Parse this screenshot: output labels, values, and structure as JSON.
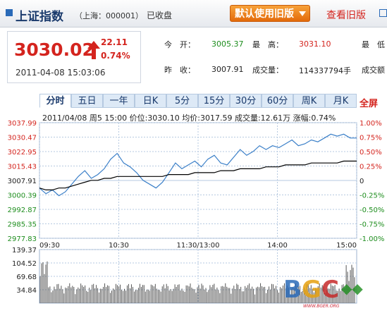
{
  "header": {
    "title": "上证指数",
    "exchange": "（上海：000001）",
    "status": "已收盘",
    "old_version_button": "默认使用旧版",
    "old_version_link": "查看旧版"
  },
  "quote": {
    "price": "3030.02",
    "change": "22.11",
    "change_pct": "0.74%",
    "timestamp": "2011-04-08 15:03:06",
    "open_label": "今　开：",
    "open": "3005.37",
    "high_label": "最　高：",
    "high": "3031.10",
    "low_label_partial": "最　低",
    "prev_close_label": "昨　收：",
    "prev_close": "3007.91",
    "volume_label": "成交量：",
    "volume": "114337794手",
    "amount_label_partial": "成交额"
  },
  "tabs": [
    "分时",
    "五日",
    "一年",
    "日K",
    "5分",
    "15分",
    "30分",
    "60分",
    "周K",
    "月K"
  ],
  "active_tab": "分时",
  "fullscreen": "全屏",
  "info_line": "2011/04/08  周5  15:00  价位:3030.10  均价:3017.59  成交量:12.61万  涨幅:0.74%",
  "colors": {
    "up": "#d4241e",
    "down": "#1d8d1d",
    "price_line": "#3a7fc8",
    "avg_line": "#000000",
    "grid": "#b6c9e0"
  },
  "chart_data": {
    "type": "line",
    "y_left_ticks": [
      "3037.99",
      "3030.47",
      "3022.95",
      "3015.43",
      "3007.91",
      "3000.39",
      "2992.87",
      "2985.35",
      "2977.83"
    ],
    "y_right_ticks": [
      "1.00%",
      "0.75%",
      "0.50%",
      "0.25%",
      "0",
      "-0.25%",
      "-0.50%",
      "-0.75%",
      "-1.00%"
    ],
    "x_ticks": [
      "09:30",
      "10:30",
      "11:30/13:00",
      "14:00",
      "15:00"
    ],
    "ylim": [
      2977.83,
      3037.99
    ],
    "series": [
      {
        "values": [
          3004,
          3001,
          3003,
          3000,
          3002,
          3006,
          3010,
          3013,
          3009,
          3011,
          3014,
          3019,
          3022,
          3017,
          3015,
          3012,
          3008,
          3006,
          3004,
          3007,
          3012,
          3017,
          3014,
          3016,
          3018,
          3015,
          3019,
          3021,
          3017,
          3016,
          3020,
          3024,
          3021,
          3023,
          3026,
          3024,
          3026,
          3025,
          3027,
          3029,
          3026,
          3027,
          3029,
          3028,
          3030,
          3032,
          3031,
          3032,
          3030,
          3030
        ]
      },
      {
        "values": [
          3004,
          3003,
          3003,
          3004,
          3004,
          3005,
          3006,
          3007,
          3008,
          3008,
          3009,
          3009,
          3010,
          3010,
          3010,
          3010,
          3010,
          3010,
          3010,
          3010,
          3011,
          3011,
          3011,
          3011,
          3012,
          3012,
          3012,
          3012,
          3013,
          3013,
          3013,
          3014,
          3014,
          3014,
          3014,
          3015,
          3015,
          3015,
          3016,
          3016,
          3016,
          3016,
          3017,
          3017,
          3017,
          3017,
          3017,
          3018,
          3018,
          3018
        ]
      }
    ],
    "volume_ticks": [
      "139.37",
      "104.52",
      "69.68",
      "34.84"
    ],
    "volume_ylim": [
      0,
      139.37
    ]
  },
  "watermark": {
    "logo": "BGC",
    "site": "WWW.BGER.ORG"
  }
}
